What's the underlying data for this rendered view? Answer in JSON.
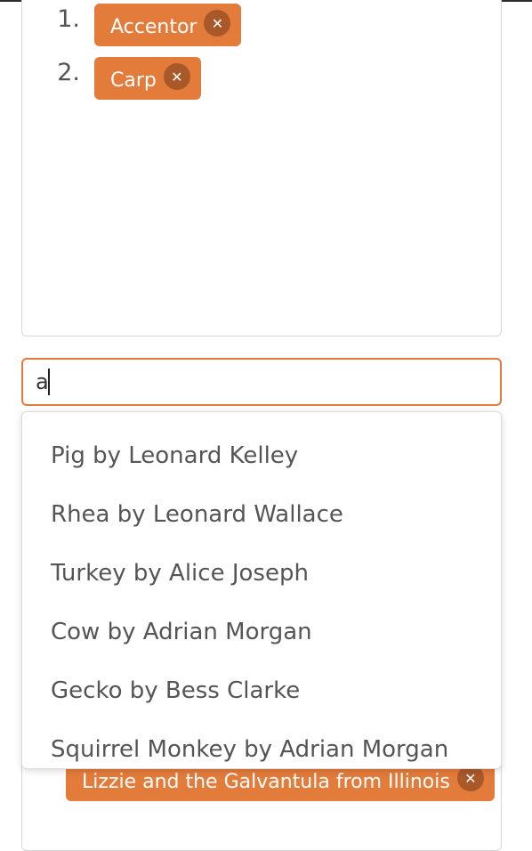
{
  "selected_list": {
    "items": [
      {
        "number": "1.",
        "label": "Accentor",
        "remove_icon": "close-icon"
      },
      {
        "number": "2.",
        "label": "Carp",
        "remove_icon": "close-icon"
      }
    ]
  },
  "search": {
    "value": "a"
  },
  "dropdown": {
    "options": [
      "Pig by Leonard Kelley",
      "Rhea by Leonard Wallace",
      "Turkey by Alice Joseph",
      "Cow by Adrian Morgan",
      "Gecko by Bess Clarke",
      "Squirrel Monkey by Adrian Morgan"
    ]
  },
  "lower_list": {
    "tag_label": "Lizzie and the Galvantula from Illinois",
    "remove_icon": "close-icon"
  },
  "colors": {
    "tag_bg": "#e37b3a",
    "tag_x_bg": "#a9582a",
    "focus_border": "#e37b3a"
  }
}
